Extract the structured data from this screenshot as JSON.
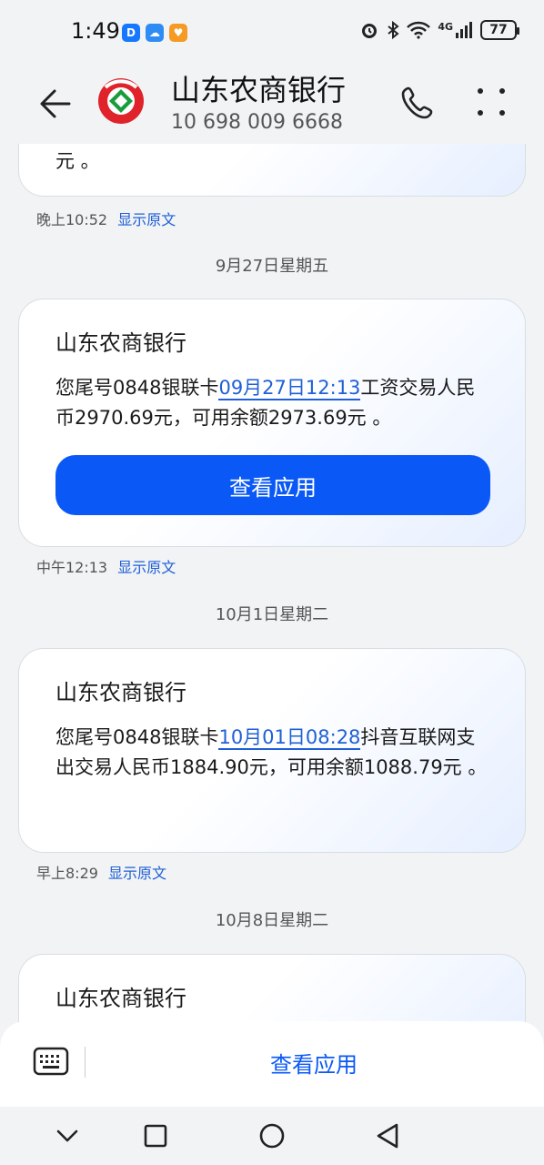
{
  "status_bar": {
    "time": "1:49",
    "network": "4G",
    "battery": "77"
  },
  "header": {
    "contact_name": "山东农商银行",
    "phone_number": "10 698 009 6668"
  },
  "messages": [
    {
      "partial_tail": "元 。",
      "time": "晚上10:52",
      "show_original": "显示原文"
    },
    {
      "date_separator": "9月27日星期五",
      "title": "山东农商银行",
      "body_pre": "您尾号0848银联卡",
      "body_link": "09月27日12:13",
      "body_post": "工资交易人民币2970.69元，可用余额2973.69元 。",
      "button": "查看应用",
      "time": "中午12:13",
      "show_original": "显示原文"
    },
    {
      "date_separator": "10月1日星期二",
      "title": "山东农商银行",
      "body_pre": "您尾号0848银联卡",
      "body_link": "10月01日08:28",
      "body_post": "抖音互联网支出交易人民币1884.90元，可用余额1088.79元 。",
      "time": "早上8:29",
      "show_original": "显示原文"
    },
    {
      "date_separator": "10月8日星期二",
      "title": "山东农商银行"
    }
  ],
  "bottom_bar": {
    "view_app": "查看应用"
  },
  "colors": {
    "accent": "#0a59f7",
    "link": "#1f5fd6",
    "logo_red": "#e0222a",
    "logo_green": "#1a9b3c"
  }
}
